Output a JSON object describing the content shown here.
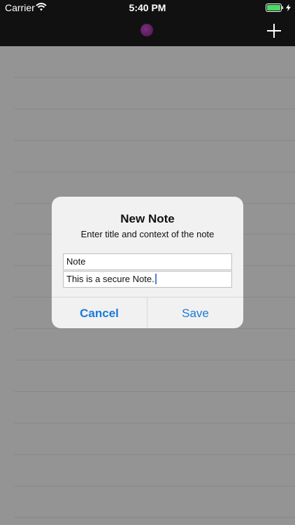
{
  "status_bar": {
    "carrier": "Carrier",
    "time": "5:40 PM",
    "wifi_icon": "wifi-icon",
    "battery_icon": "battery-charging-icon",
    "battery_color": "#4cd964"
  },
  "nav_bar": {
    "logo_icon": "app-logo-icon",
    "add_icon": "plus-icon"
  },
  "dialog": {
    "title": "New Note",
    "message": "Enter title and context of the note",
    "title_field_value": "Note",
    "context_field_value": "This is a secure Note.",
    "cancel_label": "Cancel",
    "save_label": "Save",
    "accent_color": "#1a7ad8"
  }
}
